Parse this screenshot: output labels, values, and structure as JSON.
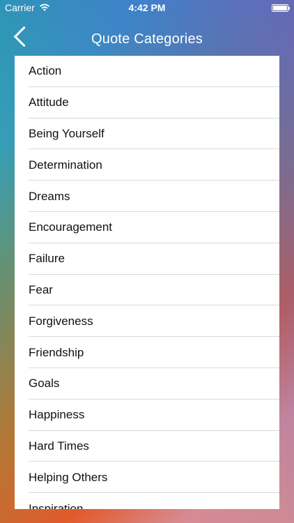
{
  "status_bar": {
    "carrier": "Carrier",
    "time": "4:42 PM"
  },
  "nav": {
    "title": "Quote Categories"
  },
  "categories": [
    "Action",
    "Attitude",
    "Being Yourself",
    "Determination",
    "Dreams",
    "Encouragement",
    "Failure",
    "Fear",
    "Forgiveness",
    "Friendship",
    "Goals",
    "Happiness",
    "Hard Times",
    "Helping Others",
    "Inspiration"
  ],
  "colors": {
    "background_top_left": "#1fb0a1",
    "background_top_right": "#625dd2",
    "background_bottom_left": "#e15a2a",
    "background_bottom_right": "#cd8a95",
    "list_background": "#ffffff",
    "separator": "#d9d9d9",
    "text": "#111111"
  },
  "icons": {
    "back": "chevron-left-icon",
    "wifi": "wifi-icon",
    "battery": "battery-icon"
  }
}
